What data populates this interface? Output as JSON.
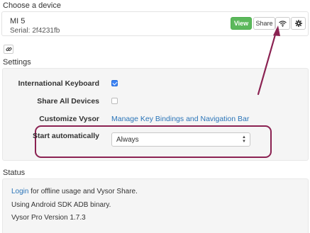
{
  "choose_device": {
    "title": "Choose a device",
    "device_name": "MI 5",
    "serial_label": "Serial:",
    "serial_value": "2f4231fb",
    "view_label": "View",
    "share_label": "Share",
    "wifi_icon": "wifi-icon",
    "settings_icon": "gear-icon"
  },
  "link_icon": "link-icon",
  "settings": {
    "title": "Settings",
    "international_keyboard_label": "International Keyboard",
    "international_keyboard_checked": true,
    "share_all_devices_label": "Share All Devices",
    "share_all_devices_checked": false,
    "customize_label": "Customize Vysor",
    "customize_link": "Manage Key Bindings and Navigation Bar",
    "start_auto_label": "Start automatically",
    "start_auto_value": "Always"
  },
  "status": {
    "title": "Status",
    "login_link": "Login",
    "login_suffix": " for offline usage and Vysor Share.",
    "adb_line": "Using Android SDK ADB binary.",
    "version_line": "Vysor Pro Version 1.7.3"
  },
  "colors": {
    "view_button": "#5cb85c",
    "link": "#2a74b8",
    "annotation": "#8b2252",
    "checkbox_checked": "#3b82f6"
  }
}
